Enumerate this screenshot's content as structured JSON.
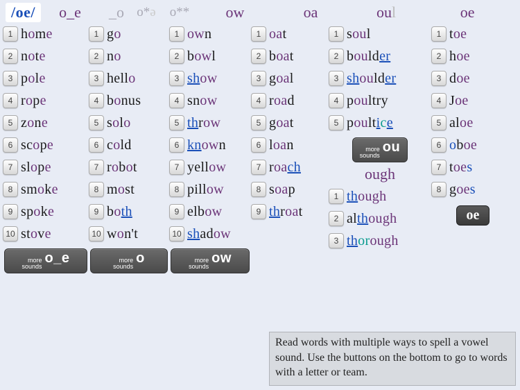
{
  "phoneme": "/oe/",
  "headers": {
    "col1": "o_e",
    "col2a": "_o",
    "col2b": "o**",
    "col3": "ow",
    "col4": "oa",
    "col5": "ou",
    "col5suffix": "l",
    "col6": "oe"
  },
  "more_label": "more sounds",
  "more_buttons": {
    "col1": "o_e",
    "col2": "o",
    "col3": "ow",
    "col5": "ou",
    "col6_badge": "oe"
  },
  "col5_sub": "ough",
  "col1_words": [
    {
      "pre": "h",
      "mid": "o",
      "post": "m",
      "suf": "e"
    },
    {
      "pre": "n",
      "mid": "o",
      "post": "t",
      "suf": "e"
    },
    {
      "pre": "p",
      "mid": "o",
      "post": "l",
      "suf": "e"
    },
    {
      "pre": "r",
      "mid": "o",
      "post": "p",
      "suf": "e"
    },
    {
      "pre": "z",
      "mid": "o",
      "post": "n",
      "suf": "e"
    },
    {
      "pre": "sc",
      "mid": "o",
      "post": "p",
      "suf": "e"
    },
    {
      "pre": "sl",
      "mid": "o",
      "post": "p",
      "suf": "e"
    },
    {
      "pre": "sm",
      "mid": "o",
      "post": "k",
      "suf": "e"
    },
    {
      "pre": "sp",
      "mid": "o",
      "post": "k",
      "suf": "e"
    },
    {
      "pre": "st",
      "mid": "o",
      "post": "v",
      "suf": "e"
    }
  ],
  "col2_words": [
    {
      "pre": "g",
      "mid": "o",
      "post": ""
    },
    {
      "pre": "n",
      "mid": "o",
      "post": ""
    },
    {
      "pre": "hell",
      "mid": "o",
      "post": ""
    },
    {
      "pre": "b",
      "mid": "o",
      "post": "nus"
    },
    {
      "pre": "s",
      "mid": "o",
      "post": "l",
      "post2": "o"
    },
    {
      "pre": "c",
      "mid": "o",
      "post": "ld"
    },
    {
      "pre": "r",
      "mid": "o",
      "post": "b",
      "post2": "o",
      "post3": "t"
    },
    {
      "pre": "m",
      "mid": "o",
      "post": "st"
    },
    {
      "pre": "b",
      "mid": "o",
      "post": "",
      "link": "th"
    },
    {
      "pre": "w",
      "mid": "o",
      "post": "n't"
    }
  ],
  "col3_words": [
    {
      "pre": "",
      "mid": "ow",
      "post": "n"
    },
    {
      "pre": "b",
      "mid": "ow",
      "post": "l"
    },
    {
      "pre": "",
      "link": "sh",
      "mid": "ow",
      "post": ""
    },
    {
      "pre": "sn",
      "mid": "ow",
      "post": ""
    },
    {
      "pre": "",
      "link": "th",
      "post": "r",
      "mid": "ow"
    },
    {
      "pre": "",
      "link": "kn",
      "mid": "ow",
      "post": "n"
    },
    {
      "pre": "yell",
      "mid": "ow",
      "post": ""
    },
    {
      "pre": "pill",
      "mid": "ow",
      "post": ""
    },
    {
      "pre": "elb",
      "mid": "ow",
      "post": ""
    },
    {
      "pre": "",
      "link": "sh",
      "post": "ad",
      "mid": "ow"
    }
  ],
  "col4_words": [
    {
      "pre": "",
      "mid": "oa",
      "post": "t"
    },
    {
      "pre": "b",
      "mid": "oa",
      "post": "t"
    },
    {
      "pre": "g",
      "mid": "oa",
      "post": "l"
    },
    {
      "pre": "r",
      "mid": "oa",
      "post": "d"
    },
    {
      "pre": "g",
      "mid": "oa",
      "post": "t"
    },
    {
      "pre": "l",
      "mid": "oa",
      "post": "n"
    },
    {
      "pre": "r",
      "mid": "oa",
      "post": "",
      "link": "ch"
    },
    {
      "pre": "s",
      "mid": "oa",
      "post": "p"
    },
    {
      "pre": "",
      "link": "th",
      "post": "r",
      "mid": "oa",
      "post2": "t"
    }
  ],
  "col5_words": [
    {
      "pre": "s",
      "mid": "ou",
      "post": "l"
    },
    {
      "pre": "b",
      "mid": "ou",
      "post": "ld",
      "link": "er"
    },
    {
      "pre": "",
      "link": "sh",
      "mid": "ou",
      "post": "ld",
      "link2": "er"
    },
    {
      "pre": "p",
      "mid": "ou",
      "post": "ltry"
    },
    {
      "pre": "p",
      "mid": "ou",
      "post": "lt",
      "link": "i",
      "teal": "c",
      "suf": "e"
    }
  ],
  "col5b_words": [
    {
      "pre": "",
      "link": "th",
      "mid": "ough",
      "post": ""
    },
    {
      "pre": "al",
      "link": "th",
      "mid": "ough",
      "post": ""
    },
    {
      "pre": "",
      "link": "th",
      "teal": "or",
      "mid": "ough",
      "post": ""
    }
  ],
  "col6_words": [
    {
      "pre": "t",
      "mid": "oe",
      "post": ""
    },
    {
      "pre": "h",
      "mid": "oe",
      "post": ""
    },
    {
      "pre": "d",
      "mid": "oe",
      "post": ""
    },
    {
      "pre": "J",
      "mid": "oe",
      "post": ""
    },
    {
      "pre": "al",
      "mid": "oe",
      "post": ""
    },
    {
      "pre": "",
      "blue": "o",
      "post": "b",
      "mid": "oe"
    },
    {
      "pre": "t",
      "mid": "oe",
      "post": "",
      "blue": "s"
    },
    {
      "pre": "g",
      "mid": "oe",
      "post": "",
      "blue": "s"
    }
  ],
  "info": "Read words with multiple ways to spell a vowel sound. Use the buttons on the bot­tom to go to words with a letter or team."
}
